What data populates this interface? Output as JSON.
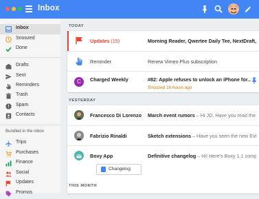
{
  "app": {
    "title": "Inbox"
  },
  "colors": {
    "accent": "#4285f4",
    "snooze": "#e37400",
    "updates": "#ea4335"
  },
  "toolbar": {
    "icons": [
      "pin-icon",
      "search-icon",
      "avatar",
      "pencil-icon"
    ]
  },
  "sidebar": {
    "items": [
      {
        "label": "Inbox",
        "icon": "inbox-icon",
        "active": true
      },
      {
        "label": "Snoozed",
        "icon": "clock-icon"
      },
      {
        "label": "Done",
        "icon": "check-icon"
      },
      {
        "label": "Drafts",
        "icon": "drafts-icon"
      },
      {
        "label": "Sent",
        "icon": "send-icon"
      },
      {
        "label": "Reminders",
        "icon": "hand-icon"
      },
      {
        "label": "Trash",
        "icon": "trash-icon"
      },
      {
        "label": "Spam",
        "icon": "spam-icon"
      },
      {
        "label": "Contacts",
        "icon": "contacts-icon"
      }
    ],
    "bundled_heading": "Bundled in the inbox",
    "bundles": [
      {
        "label": "Trips",
        "icon": "plane-icon"
      },
      {
        "label": "Purchases",
        "icon": "cart-icon"
      },
      {
        "label": "Finance",
        "icon": "finance-icon"
      },
      {
        "label": "Social",
        "icon": "social-icon"
      },
      {
        "label": "Updates",
        "icon": "flag-icon"
      },
      {
        "label": "Promos",
        "icon": "tag-icon"
      }
    ]
  },
  "sections": [
    {
      "label": "TODAY",
      "rows": [
        {
          "sender": "Updates",
          "count": "(15)",
          "subject": "Morning Reader, Qwertee Daily Tee, NextDraft,...",
          "icon": "updates-flag-icon"
        },
        {
          "sender": "Reminder",
          "subject_plain": "Renew Vimeo Plus subscription",
          "icon": "hand-icon"
        },
        {
          "sender": "Charged Weekly",
          "subject": "#82: Apple refuses to unlock an iPhone for...",
          "snooze": "Snoozed 16 hours ago",
          "icon": "letter-c-avatar",
          "avatar_letter": "C",
          "pinned": true
        }
      ]
    },
    {
      "label": "YESTERDAY",
      "rows": [
        {
          "sender": "Francesco Di Lorenzo",
          "subject": "March event rumors",
          "snippet": " – Hi JD, Have you read the P...",
          "icon": "avatar"
        },
        {
          "sender": "Fabrizio Rinaldi",
          "subject": "Sketch extensions",
          "snippet": " – Have you seen the new Extens...",
          "icon": "avatar"
        },
        {
          "sender": "Boxy App",
          "subject": "Definitive changelog",
          "snippet": " – Hi! Here's Boxy 1.1 complet...",
          "icon": "boxy-icon",
          "attachment": "Changelog"
        }
      ]
    },
    {
      "label": "THIS MONTH"
    }
  ]
}
